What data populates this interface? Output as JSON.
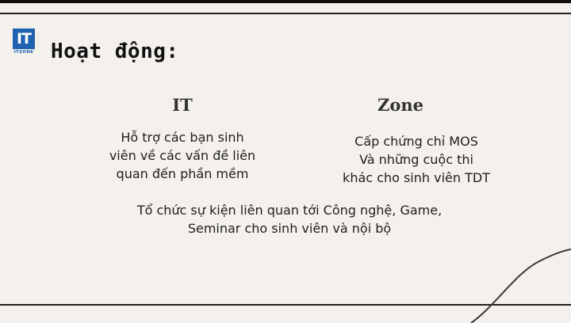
{
  "logo": {
    "mark": "IT",
    "caption": "ITZONE"
  },
  "page_title": "Hoạt động:",
  "it_column": {
    "heading": "IT",
    "lines": [
      "Hỗ trợ các bạn sinh",
      "viên về các vấn đề liên",
      "quan đến phần mềm"
    ]
  },
  "zone_column": {
    "heading": "Zone",
    "lines": [
      "Cấp chứng chỉ MOS",
      "Và những cuộc thi",
      "khác cho sinh viên TDT"
    ]
  },
  "shared": {
    "lines": [
      "Tổ chức sự kiện liên quan tới Công nghệ, Game,",
      "Seminar cho sinh viên và nội bộ"
    ]
  }
}
